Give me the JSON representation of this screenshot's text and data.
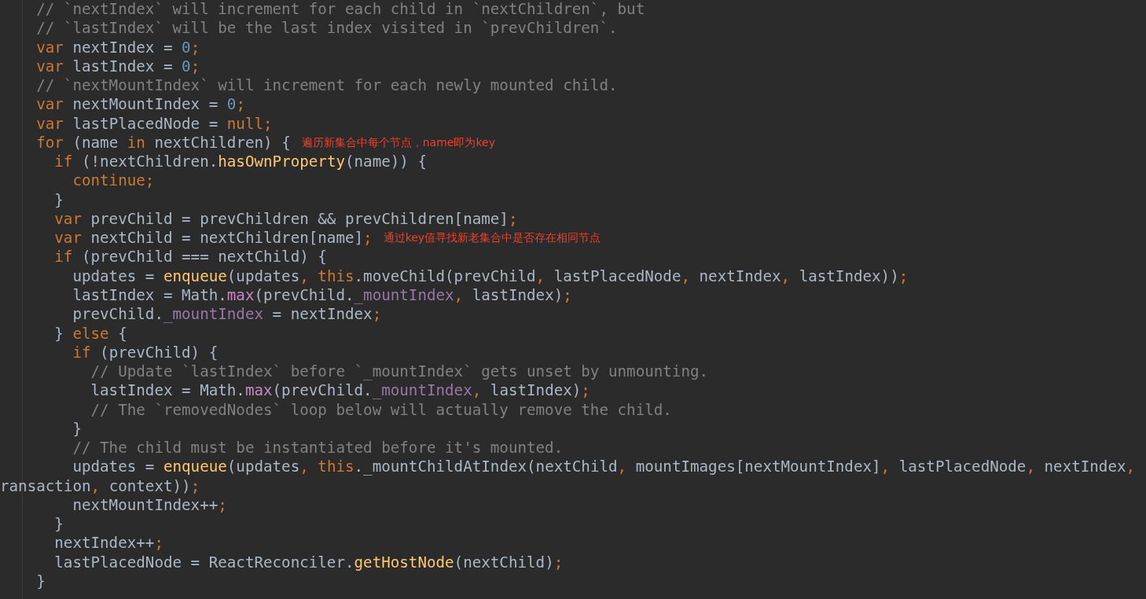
{
  "editor": {
    "lines": [
      {
        "tokens": [
          {
            "kind": "comment",
            "text": "    // `nextIndex` will increment for each child in `nextChildren`, but"
          }
        ]
      },
      {
        "tokens": [
          {
            "kind": "comment",
            "text": "    // `lastIndex` will be the last index visited in `prevChildren`."
          }
        ]
      },
      {
        "tokens": [
          {
            "kind": "keyword",
            "text": "    var"
          },
          {
            "kind": "plain",
            "text": " nextIndex = "
          },
          {
            "kind": "number",
            "text": "0"
          },
          {
            "kind": "keyword",
            "text": ";"
          }
        ]
      },
      {
        "tokens": [
          {
            "kind": "keyword",
            "text": "    var"
          },
          {
            "kind": "plain",
            "text": " lastIndex = "
          },
          {
            "kind": "number",
            "text": "0"
          },
          {
            "kind": "keyword",
            "text": ";"
          }
        ]
      },
      {
        "tokens": [
          {
            "kind": "comment",
            "text": "    // `nextMountIndex` will increment for each newly mounted child."
          }
        ]
      },
      {
        "tokens": [
          {
            "kind": "keyword",
            "text": "    var"
          },
          {
            "kind": "plain",
            "text": " nextMountIndex = "
          },
          {
            "kind": "number",
            "text": "0"
          },
          {
            "kind": "keyword",
            "text": ";"
          }
        ]
      },
      {
        "tokens": [
          {
            "kind": "keyword",
            "text": "    var"
          },
          {
            "kind": "plain",
            "text": " lastPlacedNode = "
          },
          {
            "kind": "keyword",
            "text": "null;"
          }
        ]
      },
      {
        "tokens": [
          {
            "kind": "keyword",
            "text": "    for"
          },
          {
            "kind": "plain",
            "text": " (name "
          },
          {
            "kind": "keyword",
            "text": "in"
          },
          {
            "kind": "plain",
            "text": " nextChildren) {"
          }
        ],
        "annotation": "遍历新集合中每个节点，name即为key"
      },
      {
        "tokens": [
          {
            "kind": "keyword",
            "text": "      if"
          },
          {
            "kind": "plain",
            "text": " (!nextChildren."
          },
          {
            "kind": "function",
            "text": "hasOwnProperty"
          },
          {
            "kind": "plain",
            "text": "(name)) {"
          }
        ]
      },
      {
        "tokens": [
          {
            "kind": "keyword",
            "text": "        continue;"
          }
        ]
      },
      {
        "tokens": [
          {
            "kind": "plain",
            "text": "      }"
          }
        ]
      },
      {
        "tokens": [
          {
            "kind": "keyword",
            "text": "      var"
          },
          {
            "kind": "plain",
            "text": " prevChild = prevChildren && prevChildren[name]"
          },
          {
            "kind": "keyword",
            "text": ";"
          }
        ]
      },
      {
        "tokens": [
          {
            "kind": "keyword",
            "text": "      var"
          },
          {
            "kind": "plain",
            "text": " nextChild = nextChildren[name]"
          },
          {
            "kind": "keyword",
            "text": ";"
          }
        ],
        "annotation": "通过key值寻找新老集合中是否存在相同节点"
      },
      {
        "tokens": [
          {
            "kind": "keyword",
            "text": "      if"
          },
          {
            "kind": "plain",
            "text": " (prevChild === nextChild) {"
          }
        ]
      },
      {
        "tokens": [
          {
            "kind": "plain",
            "text": "        updates = "
          },
          {
            "kind": "function",
            "text": "enqueue"
          },
          {
            "kind": "plain",
            "text": "(updates"
          },
          {
            "kind": "keyword",
            "text": ", this"
          },
          {
            "kind": "plain",
            "text": ".moveChild(prevChild"
          },
          {
            "kind": "keyword",
            "text": ","
          },
          {
            "kind": "plain",
            "text": " lastPlacedNode"
          },
          {
            "kind": "keyword",
            "text": ","
          },
          {
            "kind": "plain",
            "text": " nextIndex"
          },
          {
            "kind": "keyword",
            "text": ","
          },
          {
            "kind": "plain",
            "text": " lastIndex))"
          },
          {
            "kind": "keyword",
            "text": ";"
          }
        ]
      },
      {
        "tokens": [
          {
            "kind": "plain",
            "text": "        lastIndex = Math."
          },
          {
            "kind": "method",
            "text": "max"
          },
          {
            "kind": "plain",
            "text": "(prevChild."
          },
          {
            "kind": "property",
            "text": "_mountIndex"
          },
          {
            "kind": "keyword",
            "text": ","
          },
          {
            "kind": "plain",
            "text": " lastIndex)"
          },
          {
            "kind": "keyword",
            "text": ";"
          }
        ]
      },
      {
        "tokens": [
          {
            "kind": "plain",
            "text": "        prevChild."
          },
          {
            "kind": "property",
            "text": "_mountIndex"
          },
          {
            "kind": "plain",
            "text": " = nextIndex"
          },
          {
            "kind": "keyword",
            "text": ";"
          }
        ]
      },
      {
        "tokens": [
          {
            "kind": "plain",
            "text": "      } "
          },
          {
            "kind": "keyword",
            "text": "else"
          },
          {
            "kind": "plain",
            "text": " {"
          }
        ]
      },
      {
        "tokens": [
          {
            "kind": "keyword",
            "text": "        if"
          },
          {
            "kind": "plain",
            "text": " (prevChild) {"
          }
        ]
      },
      {
        "tokens": [
          {
            "kind": "comment",
            "text": "          // Update `lastIndex` before `_mountIndex` gets unset by unmounting."
          }
        ]
      },
      {
        "tokens": [
          {
            "kind": "plain",
            "text": "          lastIndex = Math."
          },
          {
            "kind": "method",
            "text": "max"
          },
          {
            "kind": "plain",
            "text": "(prevChild."
          },
          {
            "kind": "property",
            "text": "_mountIndex"
          },
          {
            "kind": "keyword",
            "text": ","
          },
          {
            "kind": "plain",
            "text": " lastIndex)"
          },
          {
            "kind": "keyword",
            "text": ";"
          }
        ]
      },
      {
        "tokens": [
          {
            "kind": "comment",
            "text": "          // The `removedNodes` loop below will actually remove the child."
          }
        ]
      },
      {
        "tokens": [
          {
            "kind": "plain",
            "text": "        }"
          }
        ]
      },
      {
        "tokens": [
          {
            "kind": "comment",
            "text": "        // The child must be instantiated before it's mounted."
          }
        ]
      },
      {
        "tokens": [
          {
            "kind": "plain",
            "text": "        updates = "
          },
          {
            "kind": "function",
            "text": "enqueue"
          },
          {
            "kind": "plain",
            "text": "(updates"
          },
          {
            "kind": "keyword",
            "text": ", this"
          },
          {
            "kind": "plain",
            "text": "._mountChildAtIndex(nextChild"
          },
          {
            "kind": "keyword",
            "text": ","
          },
          {
            "kind": "plain",
            "text": " mountImages[nextMountIndex]"
          },
          {
            "kind": "keyword",
            "text": ","
          },
          {
            "kind": "plain",
            "text": " lastPlacedNode"
          },
          {
            "kind": "keyword",
            "text": ","
          },
          {
            "kind": "plain",
            "text": " nextIndex"
          },
          {
            "kind": "keyword",
            "text": ","
          }
        ]
      },
      {
        "tokens": [
          {
            "kind": "plain",
            "text": "ransaction"
          },
          {
            "kind": "keyword",
            "text": ","
          },
          {
            "kind": "plain",
            "text": " context))"
          },
          {
            "kind": "keyword",
            "text": ";"
          }
        ]
      },
      {
        "tokens": [
          {
            "kind": "plain",
            "text": "        nextMountIndex++"
          },
          {
            "kind": "keyword",
            "text": ";"
          }
        ]
      },
      {
        "tokens": [
          {
            "kind": "plain",
            "text": "      }"
          }
        ]
      },
      {
        "tokens": [
          {
            "kind": "plain",
            "text": "      nextIndex++"
          },
          {
            "kind": "keyword",
            "text": ";"
          }
        ]
      },
      {
        "tokens": [
          {
            "kind": "plain",
            "text": "      lastPlacedNode = ReactReconciler."
          },
          {
            "kind": "function",
            "text": "getHostNode"
          },
          {
            "kind": "plain",
            "text": "(nextChild)"
          },
          {
            "kind": "keyword",
            "text": ";"
          }
        ]
      },
      {
        "tokens": [
          {
            "kind": "plain",
            "text": "    }"
          }
        ]
      }
    ]
  }
}
